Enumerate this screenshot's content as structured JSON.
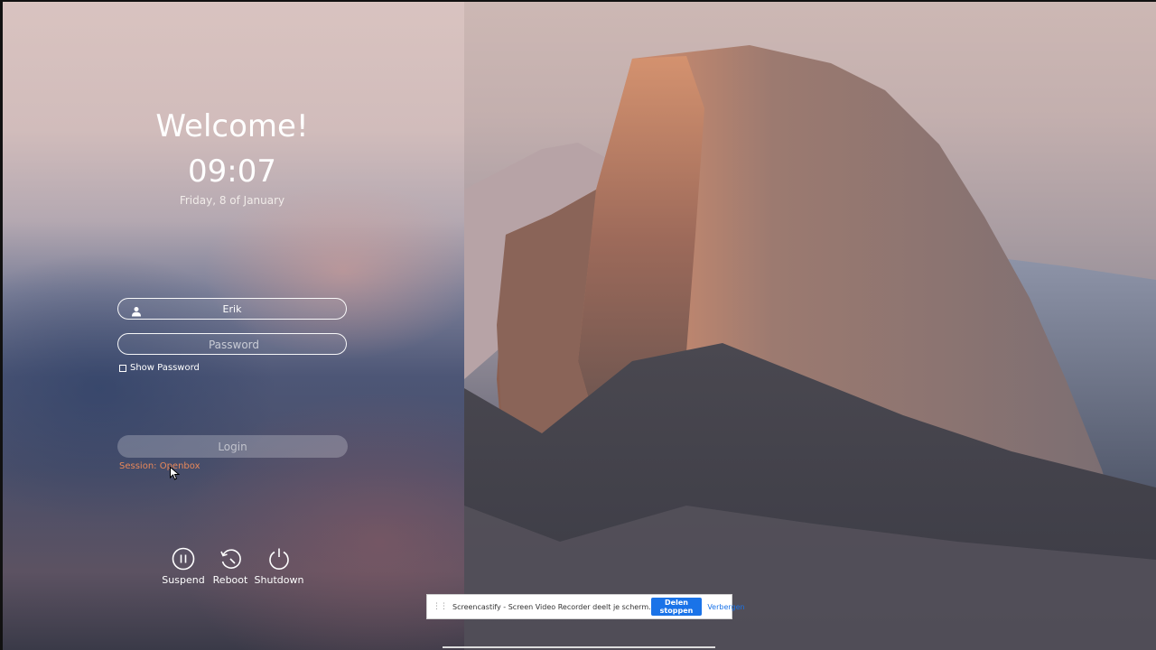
{
  "greeter": {
    "welcome": "Welcome!",
    "time": "09:07",
    "date": "Friday, 8 of January"
  },
  "login": {
    "username": "Erik",
    "password_placeholder": "Password",
    "show_password_label": "Show Password",
    "login_label": "Login",
    "session_label": "Session: Openbox"
  },
  "power": {
    "suspend": "Suspend",
    "reboot": "Reboot",
    "shutdown": "Shutdown"
  },
  "screencastify": {
    "message": "Screencastify - Screen Video Recorder deelt je scherm.",
    "stop_label": "Delen stoppen",
    "hide_label": "Verbergen"
  },
  "colors": {
    "session_text": "#e8885a",
    "stop_button": "#1a73e8"
  }
}
